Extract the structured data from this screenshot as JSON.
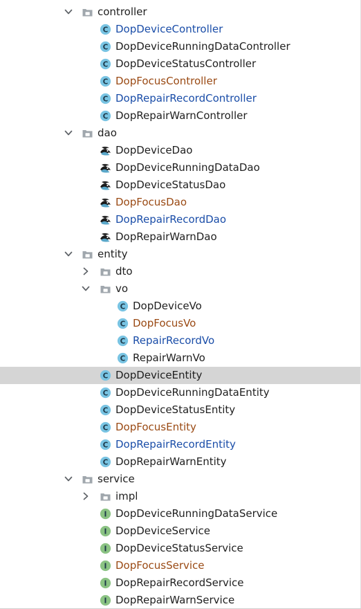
{
  "tree": [
    {
      "kind": "folder",
      "expanded": true,
      "level": 0,
      "label": "controller",
      "name": "folder-controller"
    },
    {
      "kind": "class",
      "level": 1,
      "label": "DopDeviceController",
      "color": "blue",
      "name": "class-dop-device-controller"
    },
    {
      "kind": "class",
      "level": 1,
      "label": "DopDeviceRunningDataController",
      "color": "default",
      "name": "class-dop-device-running-data-controller"
    },
    {
      "kind": "class",
      "level": 1,
      "label": "DopDeviceStatusController",
      "color": "default",
      "name": "class-dop-device-status-controller"
    },
    {
      "kind": "class",
      "level": 1,
      "label": "DopFocusController",
      "color": "brown",
      "name": "class-dop-focus-controller"
    },
    {
      "kind": "class",
      "level": 1,
      "label": "DopRepairRecordController",
      "color": "blue",
      "name": "class-dop-repair-record-controller"
    },
    {
      "kind": "class",
      "level": 1,
      "label": "DopRepairWarnController",
      "color": "default",
      "name": "class-dop-repair-warn-controller"
    },
    {
      "kind": "folder",
      "expanded": true,
      "level": 0,
      "label": "dao",
      "name": "folder-dao"
    },
    {
      "kind": "mapper",
      "level": 1,
      "label": "DopDeviceDao",
      "color": "default",
      "name": "mapper-dop-device-dao"
    },
    {
      "kind": "mapper",
      "level": 1,
      "label": "DopDeviceRunningDataDao",
      "color": "default",
      "name": "mapper-dop-device-running-data-dao"
    },
    {
      "kind": "mapper",
      "level": 1,
      "label": "DopDeviceStatusDao",
      "color": "default",
      "name": "mapper-dop-device-status-dao"
    },
    {
      "kind": "mapper",
      "level": 1,
      "label": "DopFocusDao",
      "color": "brown",
      "name": "mapper-dop-focus-dao"
    },
    {
      "kind": "mapper",
      "level": 1,
      "label": "DopRepairRecordDao",
      "color": "blue",
      "name": "mapper-dop-repair-record-dao"
    },
    {
      "kind": "mapper",
      "level": 1,
      "label": "DopRepairWarnDao",
      "color": "default",
      "name": "mapper-dop-repair-warn-dao"
    },
    {
      "kind": "folder",
      "expanded": true,
      "level": 0,
      "label": "entity",
      "name": "folder-entity"
    },
    {
      "kind": "folder",
      "expanded": false,
      "level": 1,
      "label": "dto",
      "name": "folder-dto"
    },
    {
      "kind": "folder",
      "expanded": true,
      "level": 1,
      "label": "vo",
      "name": "folder-vo"
    },
    {
      "kind": "class",
      "level": 2,
      "label": "DopDeviceVo",
      "color": "default",
      "name": "class-dop-device-vo"
    },
    {
      "kind": "class",
      "level": 2,
      "label": "DopFocusVo",
      "color": "brown",
      "name": "class-dop-focus-vo"
    },
    {
      "kind": "class",
      "level": 2,
      "label": "RepairRecordVo",
      "color": "blue",
      "name": "class-repair-record-vo"
    },
    {
      "kind": "class",
      "level": 2,
      "label": "RepairWarnVo",
      "color": "default",
      "name": "class-repair-warn-vo"
    },
    {
      "kind": "class",
      "level": 1,
      "label": "DopDeviceEntity",
      "color": "default",
      "selected": true,
      "name": "class-dop-device-entity"
    },
    {
      "kind": "class",
      "level": 1,
      "label": "DopDeviceRunningDataEntity",
      "color": "default",
      "name": "class-dop-device-running-data-entity"
    },
    {
      "kind": "class",
      "level": 1,
      "label": "DopDeviceStatusEntity",
      "color": "default",
      "name": "class-dop-device-status-entity"
    },
    {
      "kind": "class",
      "level": 1,
      "label": "DopFocusEntity",
      "color": "brown",
      "name": "class-dop-focus-entity"
    },
    {
      "kind": "class",
      "level": 1,
      "label": "DopRepairRecordEntity",
      "color": "blue",
      "name": "class-dop-repair-record-entity"
    },
    {
      "kind": "class",
      "level": 1,
      "label": "DopRepairWarnEntity",
      "color": "default",
      "name": "class-dop-repair-warn-entity"
    },
    {
      "kind": "folder",
      "expanded": true,
      "level": 0,
      "label": "service",
      "name": "folder-service"
    },
    {
      "kind": "folder",
      "expanded": false,
      "level": 1,
      "label": "impl",
      "name": "folder-impl"
    },
    {
      "kind": "interface",
      "level": 1,
      "label": "DopDeviceRunningDataService",
      "color": "default",
      "name": "interface-dop-device-running-data-service"
    },
    {
      "kind": "interface",
      "level": 1,
      "label": "DopDeviceService",
      "color": "default",
      "name": "interface-dop-device-service"
    },
    {
      "kind": "interface",
      "level": 1,
      "label": "DopDeviceStatusService",
      "color": "default",
      "name": "interface-dop-device-status-service"
    },
    {
      "kind": "interface",
      "level": 1,
      "label": "DopFocusService",
      "color": "brown",
      "name": "interface-dop-focus-service"
    },
    {
      "kind": "interface",
      "level": 1,
      "label": "DopRepairRecordService",
      "color": "default",
      "name": "interface-dop-repair-record-service"
    },
    {
      "kind": "interface",
      "level": 1,
      "label": "DopRepairWarnService",
      "color": "default",
      "name": "interface-dop-repair-warn-service"
    }
  ],
  "icons": {
    "folder": "folder-icon",
    "class": "class-icon",
    "interface": "interface-icon",
    "mapper": "mybatis-mapper-icon",
    "expanded": "chevron-down-icon",
    "collapsed": "chevron-right-icon"
  },
  "colors": {
    "class_badge": "#79c4e3",
    "interface_badge": "#8bc383",
    "folder": "#a0a7ad",
    "text_blue": "#1a4da8",
    "text_brown": "#9a4a14",
    "selection": "#d5d5d5"
  }
}
